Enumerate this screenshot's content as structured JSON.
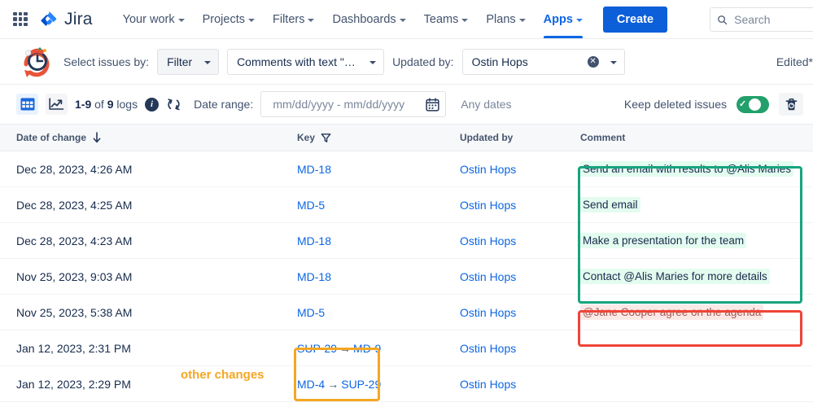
{
  "topnav": {
    "apps_icon": "grid-apps-icon",
    "brand": "Jira",
    "items": [
      {
        "label": "Your work",
        "active": false
      },
      {
        "label": "Projects",
        "active": false
      },
      {
        "label": "Filters",
        "active": false
      },
      {
        "label": "Dashboards",
        "active": false
      },
      {
        "label": "Teams",
        "active": false
      },
      {
        "label": "Plans",
        "active": false
      },
      {
        "label": "Apps",
        "active": true
      }
    ],
    "create_label": "Create",
    "search_placeholder": "Search",
    "search_value": ""
  },
  "filterbar": {
    "app_icon": "clock-history-santa-icon",
    "select_issues_label": "Select issues by:",
    "filter_select_value": "Filter",
    "comments_select_value": "Comments with text \"em…",
    "updated_by_label": "Updated by:",
    "updated_by_value": "Ostin Hops",
    "edited_label": "Edited*"
  },
  "toolbar": {
    "view_table_icon": "table-view-icon",
    "view_chart_icon": "chart-view-icon",
    "count_prefix": "1-9",
    "count_mid": " of ",
    "count_num": "9",
    "count_suffix": " logs",
    "info_icon": "info-icon",
    "refresh_icon": "refresh-icon",
    "date_range_label": "Date range:",
    "date_range_placeholder": "mm/dd/yyyy - mm/dd/yyyy",
    "date_range_value": "",
    "calendar_icon": "calendar-icon",
    "any_dates_label": "Any dates",
    "keep_deleted_label": "Keep deleted issues",
    "toggle_on": true,
    "trash_icon": "trash-icon"
  },
  "table": {
    "headers": {
      "date": "Date of change",
      "sort_icon": "sort-desc-arrow-icon",
      "key": "Key",
      "key_filter_icon": "filter-icon",
      "updated_by": "Updated by",
      "comment": "Comment"
    },
    "rows": [
      {
        "date": "Dec 28, 2023, 4:26 AM",
        "key": "MD-18",
        "key_to": "",
        "user": "Ostin Hops",
        "comment": "Send an email with results to @Alis Maries",
        "comment_style": "green"
      },
      {
        "date": "Dec 28, 2023, 4:25 AM",
        "key": "MD-5",
        "key_to": "",
        "user": "Ostin Hops",
        "comment": "Send email",
        "comment_style": "green"
      },
      {
        "date": "Dec 28, 2023, 4:23 AM",
        "key": "MD-18",
        "key_to": "",
        "user": "Ostin Hops",
        "comment": "Make a presentation for the team",
        "comment_style": "green"
      },
      {
        "date": "Nov 25, 2023, 9:03 AM",
        "key": "MD-18",
        "key_to": "",
        "user": "Ostin Hops",
        "comment": "Contact @Alis Maries for more details",
        "comment_style": "green"
      },
      {
        "date": "Nov 25, 2023, 5:38 AM",
        "key": "MD-5",
        "key_to": "",
        "user": "Ostin Hops",
        "comment": "@Jane Cooper agree on the agenda",
        "comment_style": "red"
      },
      {
        "date": "Jan 12, 2023, 2:31 PM",
        "key": "SUP-29",
        "key_to": "MD-9",
        "user": "Ostin Hops",
        "comment": "",
        "comment_style": "none"
      },
      {
        "date": "Jan 12, 2023, 2:29 PM",
        "key": "MD-4",
        "key_to": "SUP-29",
        "user": "Ostin Hops",
        "comment": "",
        "comment_style": "none"
      }
    ]
  },
  "annotations": {
    "other_changes_label": "other changes",
    "green_color": "#17a47f",
    "red_color": "#f04438",
    "orange_color": "#f5a623"
  }
}
